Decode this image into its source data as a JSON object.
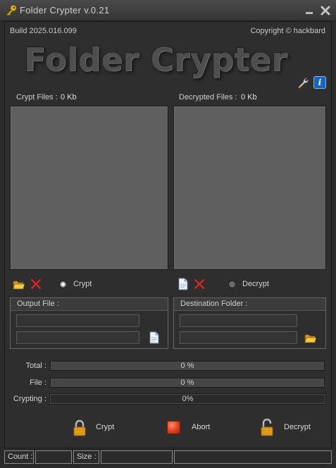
{
  "window": {
    "title": "Folder Crypter v.0.21"
  },
  "header": {
    "build": "Build 2025.016.099",
    "copyright": "Copyright © hackbard",
    "logo": "Folder Crypter"
  },
  "crypt_pane": {
    "label": "Crypt Files :",
    "size": "0 Kb",
    "radio_label": "Crypt",
    "selected": true
  },
  "decrypt_pane": {
    "label": "Decrypted Files :",
    "size": "0 Kb",
    "radio_label": "Decrypt",
    "selected": false
  },
  "output_group": {
    "title": "Output File :",
    "field1": "",
    "field2": ""
  },
  "destination_group": {
    "title": "Destination Folder :",
    "field1": "",
    "field2": ""
  },
  "progress": {
    "total": {
      "label": "Total :",
      "text": "0 %",
      "fraction": 0
    },
    "file": {
      "label": "File :",
      "text": "0 %",
      "fraction": 0
    },
    "crypting": {
      "label": "Crypting :",
      "text": "0%",
      "fraction": 0
    }
  },
  "actions": {
    "crypt": "Crypt",
    "abort": "Abort",
    "decrypt": "Decrypt"
  },
  "statusbar": {
    "count_label": "Count :",
    "count_value": "",
    "size_label": "Size :",
    "size_value": "",
    "message": ""
  },
  "colors": {
    "background": "#2e2e2e",
    "pane": "#5f5f5f",
    "abort": "#e0401f",
    "lock": "#e5a01a",
    "info": "#1565c0"
  },
  "icons": [
    "key-icon",
    "minimize-icon",
    "close-icon",
    "wrench-icon",
    "info-icon",
    "folder-open-icon",
    "delete-icon",
    "new-file-icon",
    "file-icon",
    "folder-icon",
    "lock-closed-icon",
    "stop-icon",
    "lock-open-icon"
  ]
}
